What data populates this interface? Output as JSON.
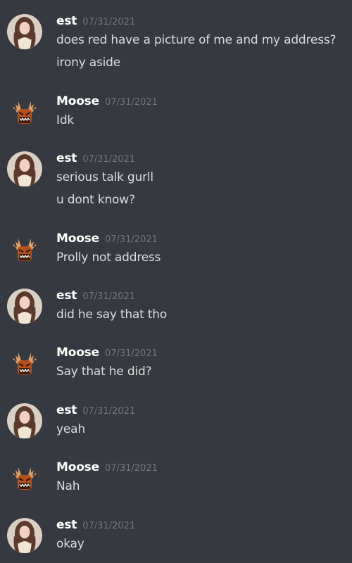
{
  "messages": [
    {
      "author": "est",
      "timestamp": "07/31/2021",
      "avatar": "woman-portrait-avatar",
      "lines": [
        "does red have a picture of me and my address?",
        "irony aside"
      ]
    },
    {
      "author": "Moose",
      "timestamp": "07/31/2021",
      "avatar": "moose-avatar",
      "lines": [
        "Idk"
      ]
    },
    {
      "author": "est",
      "timestamp": "07/31/2021",
      "avatar": "woman-portrait-avatar",
      "lines": [
        "serious talk gurll",
        "u dont know?"
      ]
    },
    {
      "author": "Moose",
      "timestamp": "07/31/2021",
      "avatar": "moose-avatar",
      "lines": [
        "Prolly not address"
      ]
    },
    {
      "author": "est",
      "timestamp": "07/31/2021",
      "avatar": "woman-portrait-avatar",
      "lines": [
        "did he say that tho"
      ]
    },
    {
      "author": "Moose",
      "timestamp": "07/31/2021",
      "avatar": "moose-avatar",
      "lines": [
        "Say that he did?"
      ]
    },
    {
      "author": "est",
      "timestamp": "07/31/2021",
      "avatar": "woman-portrait-avatar",
      "lines": [
        "yeah"
      ]
    },
    {
      "author": "Moose",
      "timestamp": "07/31/2021",
      "avatar": "moose-avatar",
      "lines": [
        "Nah"
      ]
    },
    {
      "author": "est",
      "timestamp": "07/31/2021",
      "avatar": "woman-portrait-avatar",
      "lines": [
        "okay"
      ]
    }
  ],
  "colors": {
    "background": "#36393f",
    "author": "#ffffff",
    "timestamp": "#72767d",
    "message_text": "#dcddde"
  }
}
